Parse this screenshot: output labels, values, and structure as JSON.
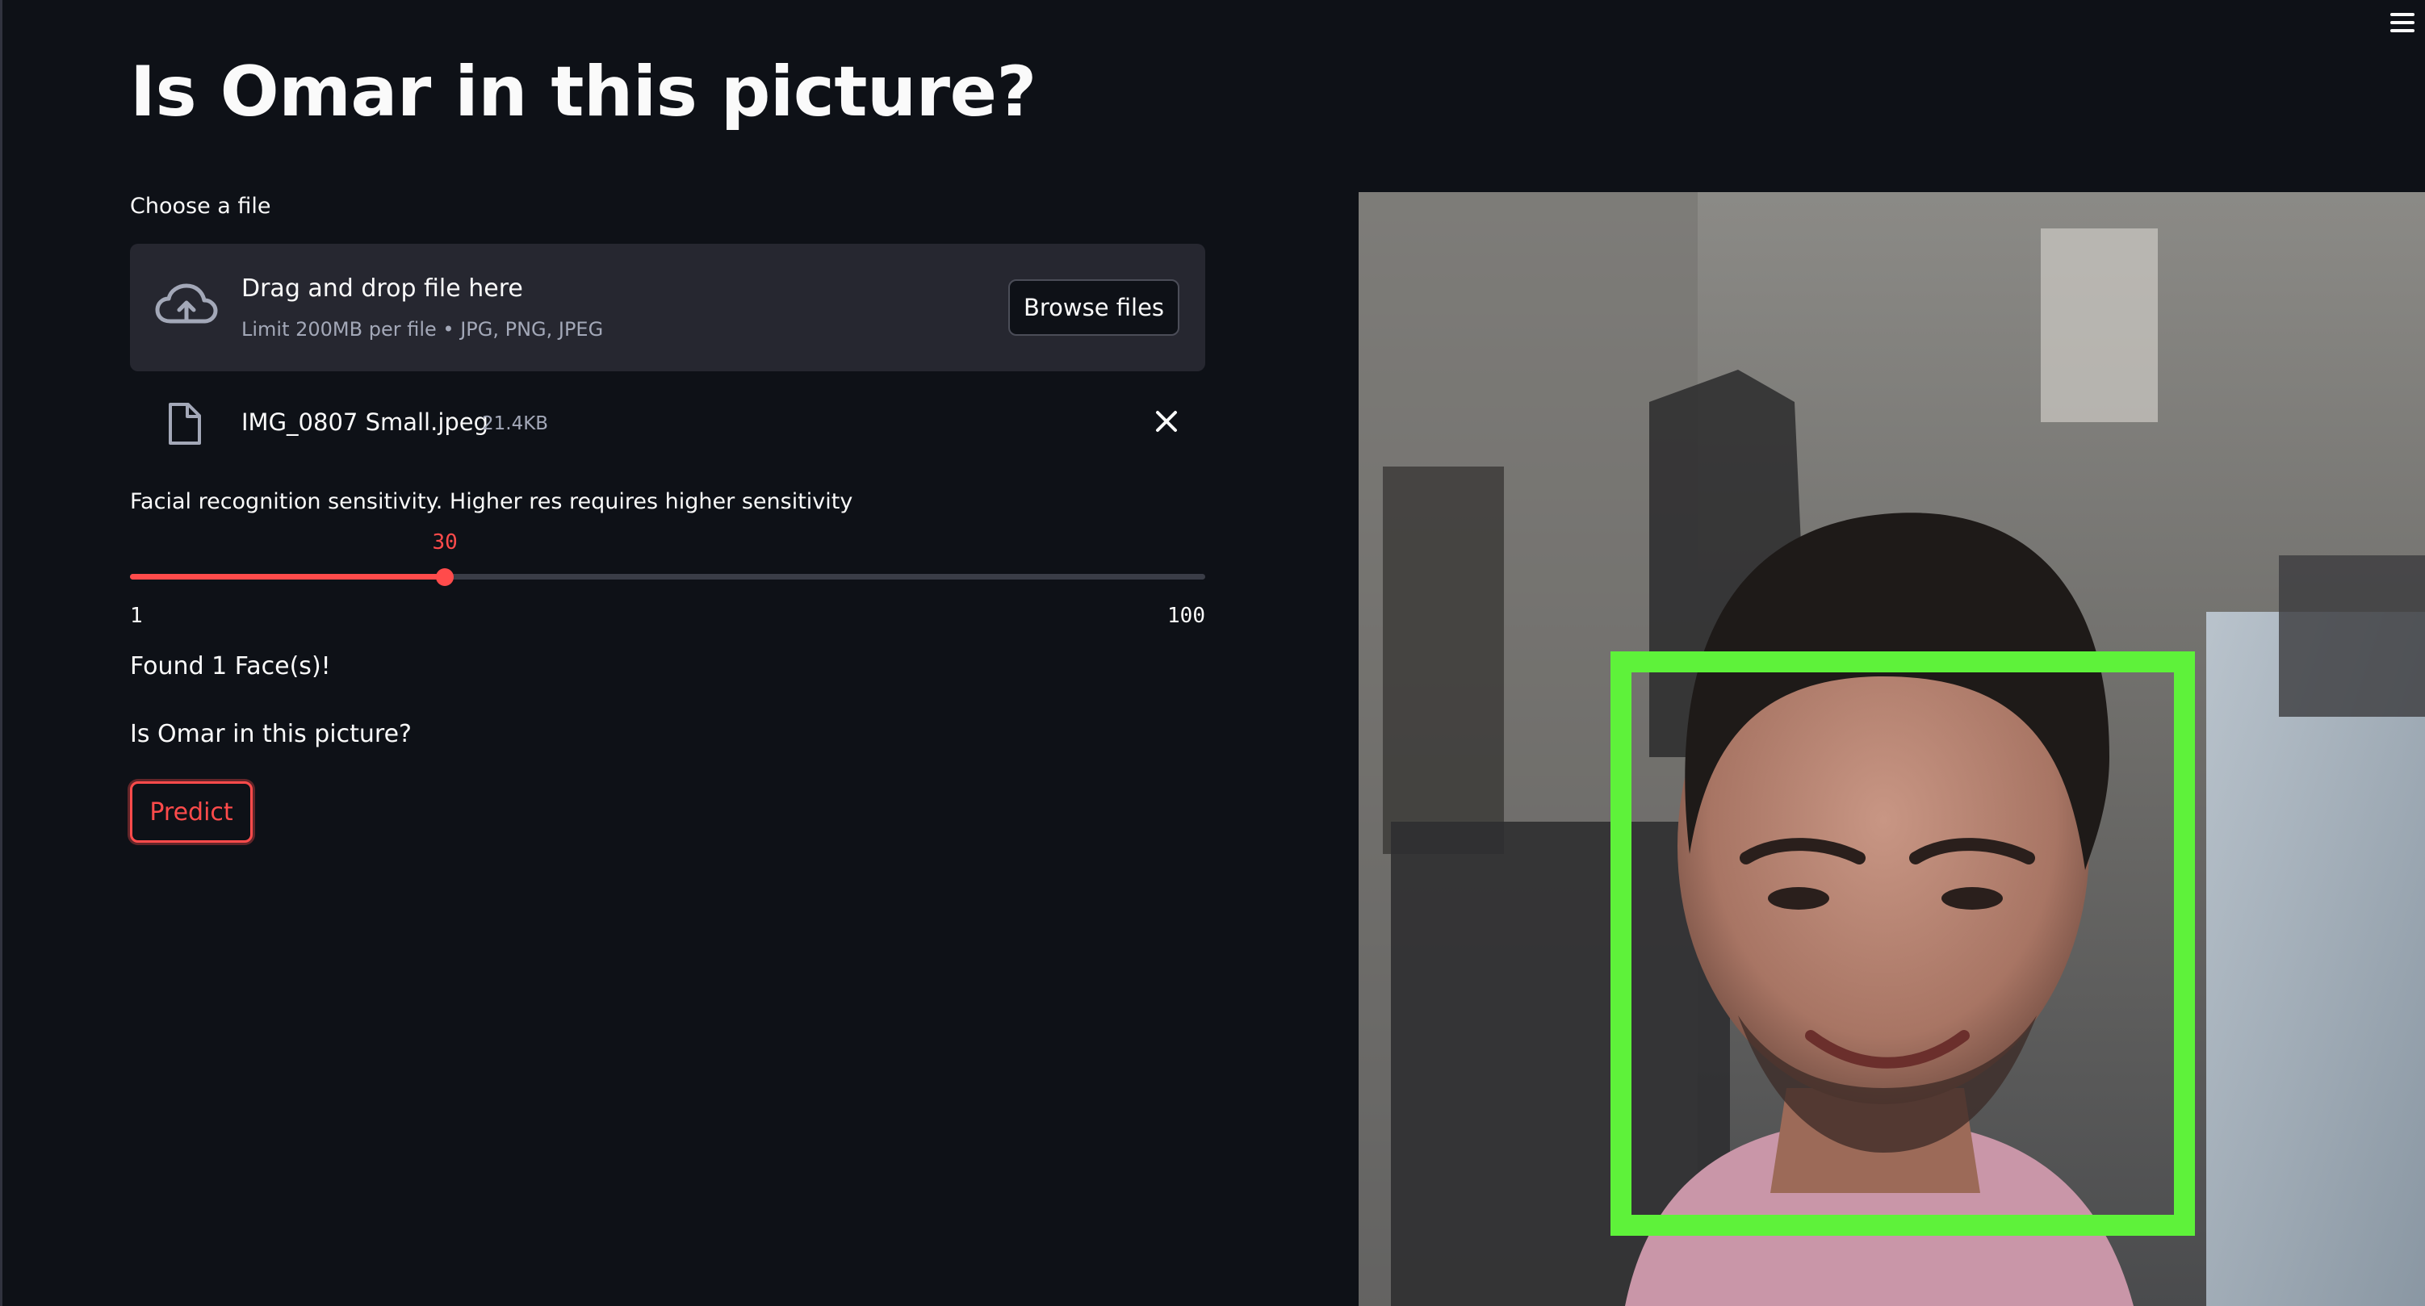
{
  "app": {
    "title": "Is Omar in this picture?"
  },
  "uploader": {
    "label": "Choose a file",
    "drop_text": "Drag and drop file here",
    "limit_text": "Limit 200MB per file • JPG, PNG, JPEG",
    "browse_label": "Browse files",
    "file": {
      "name": "IMG_0807 Small.jpeg",
      "size": "21.4KB"
    }
  },
  "slider": {
    "label": "Facial recognition sensitivity. Higher res requires higher sensitivity",
    "value": 30,
    "min": 1,
    "max": 100
  },
  "result": {
    "faces_found": "Found 1 Face(s)!",
    "question": "Is Omar in this picture?",
    "predict_label": "Predict"
  },
  "image": {
    "detection_box_color": "#5ef23a"
  },
  "theme": {
    "background": "#0e1117",
    "accent": "#ff4b4b",
    "surface": "#262730"
  },
  "icons": {
    "menu": "hamburger-menu-icon",
    "upload": "cloud-upload-icon",
    "file": "file-icon",
    "close": "close-icon",
    "expand": "expand-icon"
  }
}
